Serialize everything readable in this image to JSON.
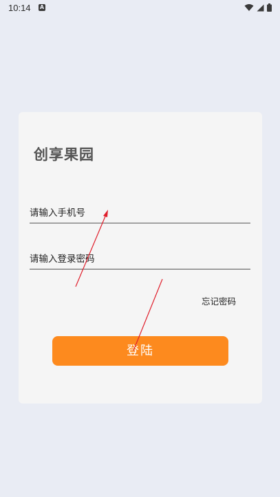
{
  "status_bar": {
    "time": "10:14",
    "notification_icon": "a-notification-icon",
    "wifi_icon": "wifi-icon",
    "signal_icon": "signal-icon",
    "battery_icon": "battery-icon"
  },
  "login_card": {
    "title": "创享果园",
    "phone_placeholder": "请输入手机号",
    "password_placeholder": "请输入登录密码",
    "forgot_password": "忘记密码",
    "login_button": "登陆"
  },
  "colors": {
    "background": "#e9ecf4",
    "card": "#f5f5f5",
    "accent": "#fd8a1e",
    "annotation_arrow": "#e01e2b"
  }
}
